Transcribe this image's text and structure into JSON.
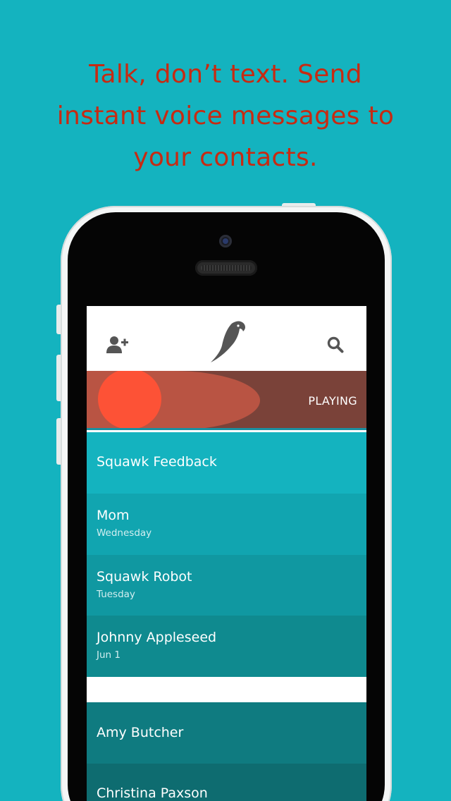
{
  "headline": {
    "line1": "Talk, don’t text. Send",
    "line2": "instant voice messages to",
    "line3": "your contacts."
  },
  "app": {
    "header": {
      "add_contact_icon": "add-contact-icon",
      "logo_icon": "parrot-logo-icon",
      "search_icon": "search-icon"
    },
    "player": {
      "status": "PLAYING",
      "progress_fraction": 0.62
    },
    "conversations": [
      {
        "name": "Squawk Feedback",
        "subtitle": ""
      },
      {
        "name": "Mom",
        "subtitle": "Wednesday"
      },
      {
        "name": "Squawk Robot",
        "subtitle": "Tuesday"
      },
      {
        "name": "Johnny Appleseed",
        "subtitle": "Jun 1"
      }
    ],
    "contacts": [
      {
        "name": "Amy Butcher"
      },
      {
        "name": "Christina Paxson"
      }
    ]
  },
  "colors": {
    "background": "#14b3bf",
    "headline": "#c72a12",
    "player_bg": "#7a4239",
    "player_progress": "#b95443",
    "player_dot": "#fd5236",
    "row_1": "#14b3bf",
    "row_2": "#11a5b0",
    "row_3": "#1098a1",
    "row_4": "#0f8a8f",
    "contact_1": "#0f7b80",
    "contact_2": "#0e6c70"
  }
}
